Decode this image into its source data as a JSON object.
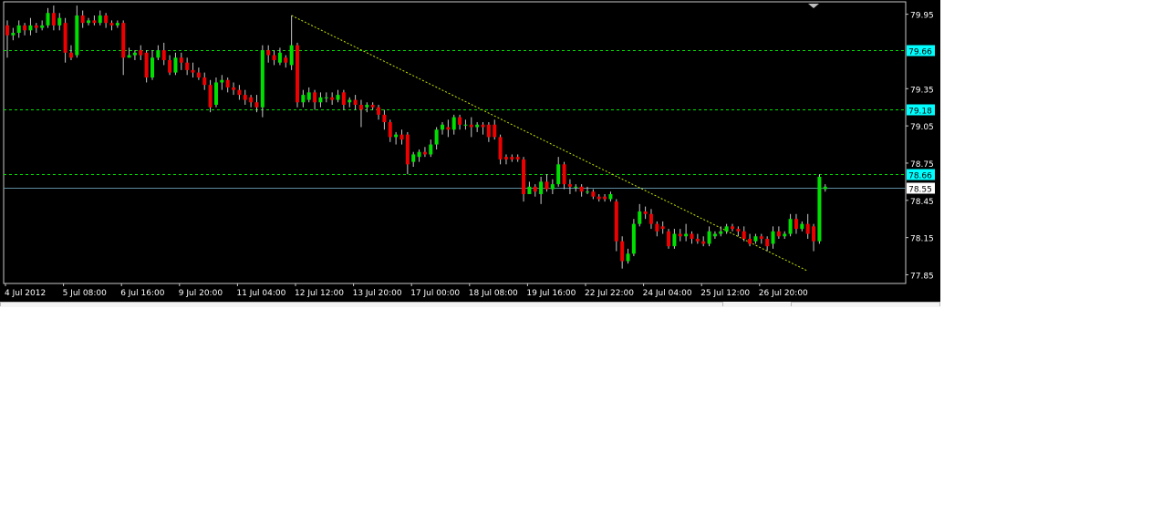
{
  "chart_data": {
    "type": "candlestick",
    "ylim": [
      77.78,
      80.05
    ],
    "y_ticks": [
      "79.95",
      "79.35",
      "79.05",
      "78.75",
      "78.45",
      "78.15",
      "77.85"
    ],
    "x_tick_labels": [
      "4 Jul 2012",
      "5 Jul 08:00",
      "6 Jul 16:00",
      "9 Jul 20:00",
      "11 Jul 04:00",
      "12 Jul 12:00",
      "13 Jul 20:00",
      "17 Jul 00:00",
      "18 Jul 08:00",
      "19 Jul 16:00",
      "22 Jul 22:00",
      "24 Jul 04:00",
      "25 Jul 12:00",
      "26 Jul 20:00"
    ],
    "horizontal_levels": [
      {
        "label": "79.66",
        "value": 79.66,
        "style": "dashed"
      },
      {
        "label": "79.18",
        "value": 79.18,
        "style": "dashed"
      },
      {
        "label": "78.66",
        "value": 78.66,
        "style": "dashed"
      }
    ],
    "current_price": {
      "label": "78.55",
      "value": 78.55
    },
    "trendline": {
      "from": {
        "bar": 49,
        "value": 79.94
      },
      "to": {
        "bar": 138,
        "value": 77.88
      }
    },
    "colors": {
      "background": "#000000",
      "bull": "#00e000",
      "bear": "#ee0000",
      "wick": "#c8c8c8",
      "dashed_level": "#00e000",
      "trendline": "#c8e600",
      "level_label_bg": "#00ffff",
      "current_line": "#5f8da0",
      "axis_text": "#ffffff"
    },
    "candles": [
      [
        79.86,
        79.78,
        79.9,
        79.6
      ],
      [
        79.78,
        79.8,
        79.84,
        79.74
      ],
      [
        79.8,
        79.86,
        79.9,
        79.76
      ],
      [
        79.86,
        79.82,
        79.88,
        79.78
      ],
      [
        79.82,
        79.86,
        79.92,
        79.78
      ],
      [
        79.86,
        79.84,
        79.88,
        79.8
      ],
      [
        79.84,
        79.86,
        79.9,
        79.82
      ],
      [
        79.86,
        79.96,
        80.0,
        79.84
      ],
      [
        79.96,
        79.86,
        80.02,
        79.82
      ],
      [
        79.86,
        79.92,
        79.96,
        79.82
      ],
      [
        79.88,
        79.64,
        79.92,
        79.56
      ],
      [
        79.64,
        79.6,
        79.7,
        79.58
      ],
      [
        79.62,
        79.94,
        80.02,
        79.6
      ],
      [
        79.94,
        79.88,
        79.98,
        79.84
      ],
      [
        79.88,
        79.9,
        79.92,
        79.86
      ],
      [
        79.9,
        79.88,
        79.94,
        79.86
      ],
      [
        79.88,
        79.94,
        79.98,
        79.86
      ],
      [
        79.94,
        79.88,
        79.96,
        79.84
      ],
      [
        79.88,
        79.86,
        79.9,
        79.82
      ],
      [
        79.86,
        79.88,
        79.9,
        79.84
      ],
      [
        79.88,
        79.6,
        79.9,
        79.46
      ],
      [
        79.6,
        79.62,
        79.68,
        79.6
      ],
      [
        79.62,
        79.64,
        79.66,
        79.58
      ],
      [
        79.66,
        79.62,
        79.7,
        79.58
      ],
      [
        79.64,
        79.44,
        79.66,
        79.4
      ],
      [
        79.44,
        79.6,
        79.66,
        79.42
      ],
      [
        79.6,
        79.66,
        79.7,
        79.58
      ],
      [
        79.66,
        79.58,
        79.72,
        79.54
      ],
      [
        79.58,
        79.48,
        79.62,
        79.46
      ],
      [
        79.48,
        79.6,
        79.64,
        79.46
      ],
      [
        79.6,
        79.56,
        79.64,
        79.5
      ],
      [
        79.56,
        79.5,
        79.6,
        79.46
      ],
      [
        79.5,
        79.48,
        79.56,
        79.44
      ],
      [
        79.48,
        79.44,
        79.52,
        79.42
      ],
      [
        79.44,
        79.38,
        79.48,
        79.34
      ],
      [
        79.38,
        79.2,
        79.42,
        79.16
      ],
      [
        79.22,
        79.4,
        79.44,
        79.2
      ],
      [
        79.4,
        79.42,
        79.46,
        79.34
      ],
      [
        79.42,
        79.36,
        79.44,
        79.32
      ],
      [
        79.36,
        79.34,
        79.4,
        79.3
      ],
      [
        79.34,
        79.3,
        79.38,
        79.26
      ],
      [
        79.3,
        79.26,
        79.34,
        79.22
      ],
      [
        79.28,
        79.24,
        79.3,
        79.2
      ],
      [
        79.24,
        79.2,
        79.3,
        79.16
      ],
      [
        79.2,
        79.66,
        79.7,
        79.12
      ],
      [
        79.66,
        79.62,
        79.7,
        79.56
      ],
      [
        79.62,
        79.58,
        79.66,
        79.54
      ],
      [
        79.56,
        79.64,
        79.68,
        79.54
      ],
      [
        79.6,
        79.56,
        79.62,
        79.52
      ],
      [
        79.54,
        79.7,
        79.94,
        79.5
      ],
      [
        79.7,
        79.24,
        79.72,
        79.2
      ],
      [
        79.24,
        79.3,
        79.34,
        79.2
      ],
      [
        79.26,
        79.32,
        79.36,
        79.24
      ],
      [
        79.32,
        79.24,
        79.34,
        79.18
      ],
      [
        79.24,
        79.28,
        79.32,
        79.2
      ],
      [
        79.28,
        79.28,
        79.32,
        79.24
      ],
      [
        79.28,
        79.26,
        79.32,
        79.22
      ],
      [
        79.26,
        79.3,
        79.34,
        79.24
      ],
      [
        79.32,
        79.22,
        79.34,
        79.18
      ],
      [
        79.24,
        79.26,
        79.28,
        79.2
      ],
      [
        79.26,
        79.22,
        79.3,
        79.18
      ],
      [
        79.22,
        79.18,
        79.26,
        79.04
      ],
      [
        79.2,
        79.22,
        79.24,
        79.16
      ],
      [
        79.22,
        79.2,
        79.24,
        79.18
      ],
      [
        79.2,
        79.14,
        79.22,
        79.1
      ],
      [
        79.14,
        79.08,
        79.18,
        79.02
      ],
      [
        79.08,
        78.96,
        79.1,
        78.92
      ],
      [
        78.96,
        78.98,
        79.0,
        78.9
      ],
      [
        78.98,
        78.94,
        79.02,
        78.9
      ],
      [
        78.98,
        78.74,
        79.0,
        78.66
      ],
      [
        78.76,
        78.82,
        78.84,
        78.72
      ],
      [
        78.8,
        78.84,
        78.86,
        78.76
      ],
      [
        78.84,
        78.82,
        78.88,
        78.8
      ],
      [
        78.82,
        78.9,
        78.94,
        78.8
      ],
      [
        78.9,
        79.02,
        79.04,
        78.86
      ],
      [
        79.02,
        79.06,
        79.08,
        78.98
      ],
      [
        79.04,
        79.02,
        79.1,
        78.96
      ],
      [
        79.02,
        79.12,
        79.14,
        78.98
      ],
      [
        79.12,
        79.06,
        79.14,
        79.02
      ],
      [
        79.06,
        79.06,
        79.1,
        79.02
      ],
      [
        79.06,
        79.04,
        79.12,
        78.96
      ],
      [
        79.04,
        79.06,
        79.08,
        79.0
      ],
      [
        79.06,
        79.04,
        79.08,
        78.98
      ],
      [
        79.06,
        78.96,
        79.08,
        78.92
      ],
      [
        79.06,
        78.96,
        79.1,
        78.94
      ],
      [
        78.96,
        78.78,
        78.98,
        78.74
      ],
      [
        78.8,
        78.78,
        78.82,
        78.74
      ],
      [
        78.8,
        78.78,
        78.82,
        78.76
      ],
      [
        78.8,
        78.78,
        78.82,
        78.76
      ],
      [
        78.78,
        78.5,
        78.8,
        78.44
      ],
      [
        78.5,
        78.56,
        78.6,
        78.5
      ],
      [
        78.56,
        78.52,
        78.58,
        78.48
      ],
      [
        78.5,
        78.6,
        78.64,
        78.42
      ],
      [
        78.6,
        78.54,
        78.66,
        78.52
      ],
      [
        78.54,
        78.58,
        78.62,
        78.5
      ],
      [
        78.58,
        78.74,
        78.8,
        78.56
      ],
      [
        78.74,
        78.58,
        78.76,
        78.54
      ],
      [
        78.58,
        78.56,
        78.62,
        78.5
      ],
      [
        78.56,
        78.56,
        78.58,
        78.52
      ],
      [
        78.56,
        78.52,
        78.58,
        78.48
      ],
      [
        78.52,
        78.52,
        78.56,
        78.5
      ],
      [
        78.52,
        78.48,
        78.54,
        78.46
      ],
      [
        78.48,
        78.46,
        78.5,
        78.44
      ],
      [
        78.48,
        78.46,
        78.5,
        78.44
      ],
      [
        78.46,
        78.5,
        78.52,
        78.44
      ],
      [
        78.44,
        78.12,
        78.46,
        78.04
      ],
      [
        78.12,
        77.96,
        78.16,
        77.9
      ],
      [
        77.96,
        78.02,
        78.06,
        77.94
      ],
      [
        78.02,
        78.26,
        78.3,
        78.0
      ],
      [
        78.26,
        78.36,
        78.42,
        78.24
      ],
      [
        78.36,
        78.34,
        78.4,
        78.3
      ],
      [
        78.34,
        78.26,
        78.38,
        78.22
      ],
      [
        78.26,
        78.2,
        78.28,
        78.16
      ],
      [
        78.24,
        78.22,
        78.28,
        78.18
      ],
      [
        78.2,
        78.08,
        78.22,
        78.06
      ],
      [
        78.08,
        78.18,
        78.22,
        78.06
      ],
      [
        78.18,
        78.16,
        78.22,
        78.12
      ],
      [
        78.16,
        78.18,
        78.26,
        78.12
      ],
      [
        78.18,
        78.14,
        78.2,
        78.1
      ],
      [
        78.14,
        78.12,
        78.18,
        78.1
      ],
      [
        78.12,
        78.1,
        78.16,
        78.08
      ],
      [
        78.1,
        78.2,
        78.24,
        78.08
      ],
      [
        78.16,
        78.18,
        78.2,
        78.14
      ],
      [
        78.18,
        78.2,
        78.24,
        78.16
      ],
      [
        78.2,
        78.24,
        78.26,
        78.18
      ],
      [
        78.24,
        78.22,
        78.26,
        78.2
      ],
      [
        78.22,
        78.2,
        78.24,
        78.16
      ],
      [
        78.2,
        78.14,
        78.24,
        78.12
      ],
      [
        78.14,
        78.1,
        78.18,
        78.08
      ],
      [
        78.12,
        78.16,
        78.18,
        78.1
      ],
      [
        78.16,
        78.14,
        78.18,
        78.1
      ],
      [
        78.14,
        78.08,
        78.16,
        78.04
      ],
      [
        78.1,
        78.2,
        78.24,
        78.06
      ],
      [
        78.2,
        78.16,
        78.24,
        78.14
      ],
      [
        78.16,
        78.18,
        78.2,
        78.14
      ],
      [
        78.18,
        78.3,
        78.34,
        78.16
      ],
      [
        78.3,
        78.22,
        78.34,
        78.18
      ],
      [
        78.22,
        78.26,
        78.28,
        78.2
      ],
      [
        78.26,
        78.18,
        78.34,
        78.14
      ],
      [
        78.24,
        78.12,
        78.26,
        78.04
      ],
      [
        78.12,
        78.64,
        78.66,
        78.1
      ],
      [
        78.54,
        78.56,
        78.58,
        78.52
      ]
    ]
  }
}
